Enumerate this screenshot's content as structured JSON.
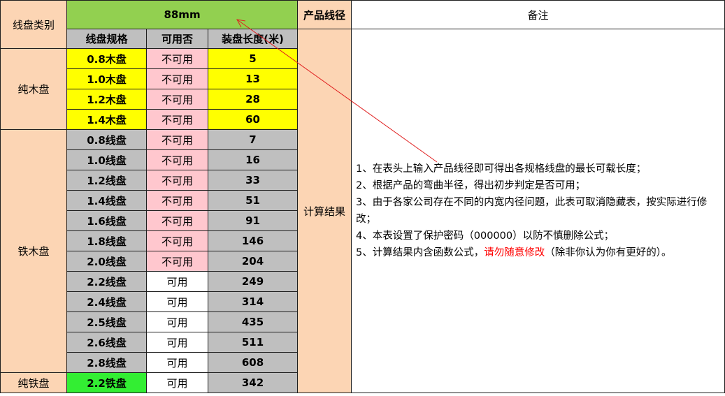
{
  "header": {
    "category_label": "线盘类别",
    "diameter_value": "88mm",
    "product_diameter_label": "产品线径",
    "remarks_label": "备注",
    "spec_label": "线盘规格",
    "availability_label": "可用否",
    "length_label": "装盘长度(米)",
    "result_label": "计算结果"
  },
  "groups": [
    {
      "name": "纯木盘",
      "color": "#000000"
    },
    {
      "name": "铁木盘",
      "color": "#ff0000"
    },
    {
      "name": "纯铁盘",
      "color": "#000000"
    }
  ],
  "rows": [
    {
      "spec": "0.8木盘",
      "status": "不可用",
      "length": "5"
    },
    {
      "spec": "1.0木盘",
      "status": "不可用",
      "length": "13"
    },
    {
      "spec": "1.2木盘",
      "status": "不可用",
      "length": "28"
    },
    {
      "spec": "1.4木盘",
      "status": "不可用",
      "length": "60"
    },
    {
      "spec": "0.8线盘",
      "status": "不可用",
      "length": "7"
    },
    {
      "spec": "1.0线盘",
      "status": "不可用",
      "length": "16"
    },
    {
      "spec": "1.2线盘",
      "status": "不可用",
      "length": "33"
    },
    {
      "spec": "1.4线盘",
      "status": "不可用",
      "length": "51"
    },
    {
      "spec": "1.6线盘",
      "status": "不可用",
      "length": "91"
    },
    {
      "spec": "1.8线盘",
      "status": "不可用",
      "length": "146"
    },
    {
      "spec": "2.0线盘",
      "status": "不可用",
      "length": "204"
    },
    {
      "spec": "2.2线盘",
      "status": "可用",
      "length": "249"
    },
    {
      "spec": "2.4线盘",
      "status": "可用",
      "length": "314"
    },
    {
      "spec": "2.5线盘",
      "status": "可用",
      "length": "435"
    },
    {
      "spec": "2.6线盘",
      "status": "可用",
      "length": "511"
    },
    {
      "spec": "2.8线盘",
      "status": "可用",
      "length": "608"
    },
    {
      "spec": "2.2铁盘",
      "status": "可用",
      "length": "342"
    }
  ],
  "notes": {
    "line1": "1、在表头上输入产品线径即可得出各规格线盘的最长可载长度；",
    "line2": "2、根据产品的弯曲半径，得出初步判定是否可用；",
    "line3": "3、由于各家公司存在不同的内宽内径问题，此表可取消隐藏表，按实际进行修改；",
    "line4": "4、本表设置了保护密码（000000）以防不慎删除公式；",
    "line5_prefix": "5、计算结果内含函数公式，",
    "line5_warning": "请勿随意修改",
    "line5_suffix": "（除非你认为你有更好的）。"
  },
  "colors": {
    "peach": "#fcd5b4",
    "header_green": "#92d050",
    "gray": "#bfbfbf",
    "yellow": "#ffff00",
    "unavailable_pink": "#ffc7ce",
    "iron_green": "#33ee33",
    "length_blue": "#1515c9",
    "warning_red": "#ff0000",
    "arrow_red": "#e02020"
  }
}
